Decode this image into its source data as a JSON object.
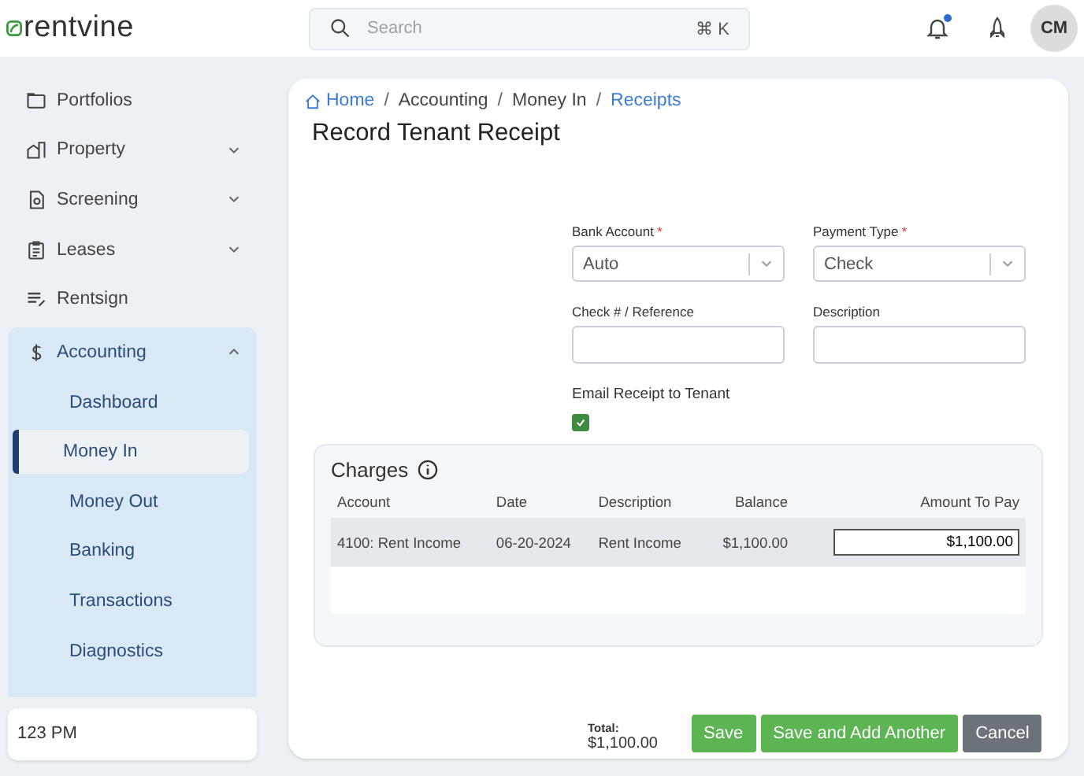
{
  "header": {
    "logo": "rentvine",
    "search": {
      "placeholder": "Search",
      "shortcut": "⌘ K"
    },
    "notification_unread": true,
    "avatar": "CM"
  },
  "sidebar": {
    "items": [
      {
        "label": "Portfolios",
        "kind": "link"
      },
      {
        "label": "Property",
        "kind": "group",
        "expanded": false
      },
      {
        "label": "Screening",
        "kind": "group",
        "expanded": false
      },
      {
        "label": "Leases",
        "kind": "group",
        "expanded": false
      },
      {
        "label": "Rentsign",
        "kind": "link"
      },
      {
        "label": "Accounting",
        "kind": "group",
        "expanded": true,
        "children": [
          {
            "label": "Dashboard",
            "selected": false
          },
          {
            "label": "Money In",
            "selected": true
          },
          {
            "label": "Money Out",
            "selected": false
          },
          {
            "label": "Banking",
            "selected": false
          },
          {
            "label": "Transactions",
            "selected": false
          },
          {
            "label": "Diagnostics",
            "selected": false
          }
        ]
      }
    ],
    "footer": "123 PM"
  },
  "breadcrumb": [
    {
      "label": "Home",
      "kind": "link"
    },
    {
      "separator": "/",
      "label": "Accounting",
      "kind": "text"
    },
    {
      "separator": "/",
      "label": "Money In",
      "kind": "text"
    },
    {
      "separator": "/",
      "label": "Receipts",
      "kind": "link"
    }
  ],
  "title": "Record Tenant Receipt",
  "fields": [
    {
      "label": "Bank Account",
      "required_mark": "*",
      "kind": "select",
      "value": "Auto"
    },
    {
      "label": "Payment Type",
      "required_mark": "*",
      "kind": "select",
      "value": "Check"
    },
    {
      "label": "Check # / Reference",
      "kind": "text"
    },
    {
      "label": "Description",
      "kind": "text"
    }
  ],
  "email_receipt": {
    "label": "Email Receipt to Tenant",
    "checked": true
  },
  "charges": {
    "title": "Charges",
    "columns": [
      "Account",
      "Date",
      "Description",
      "Balance",
      "Amount To Pay"
    ],
    "rows": [
      {
        "account": "4100: Rent Income",
        "date": "06-20-2024",
        "description": "Rent Income",
        "balance": "$1,100.00",
        "amount": "$1,100.00"
      }
    ]
  },
  "total": {
    "label": "Total:",
    "value": "$1,100.00"
  },
  "buttons": [
    {
      "label": "Save",
      "kind": "primary"
    },
    {
      "label": "Save and Add Another",
      "kind": "primary"
    },
    {
      "label": "Cancel",
      "kind": "secondary"
    }
  ]
}
